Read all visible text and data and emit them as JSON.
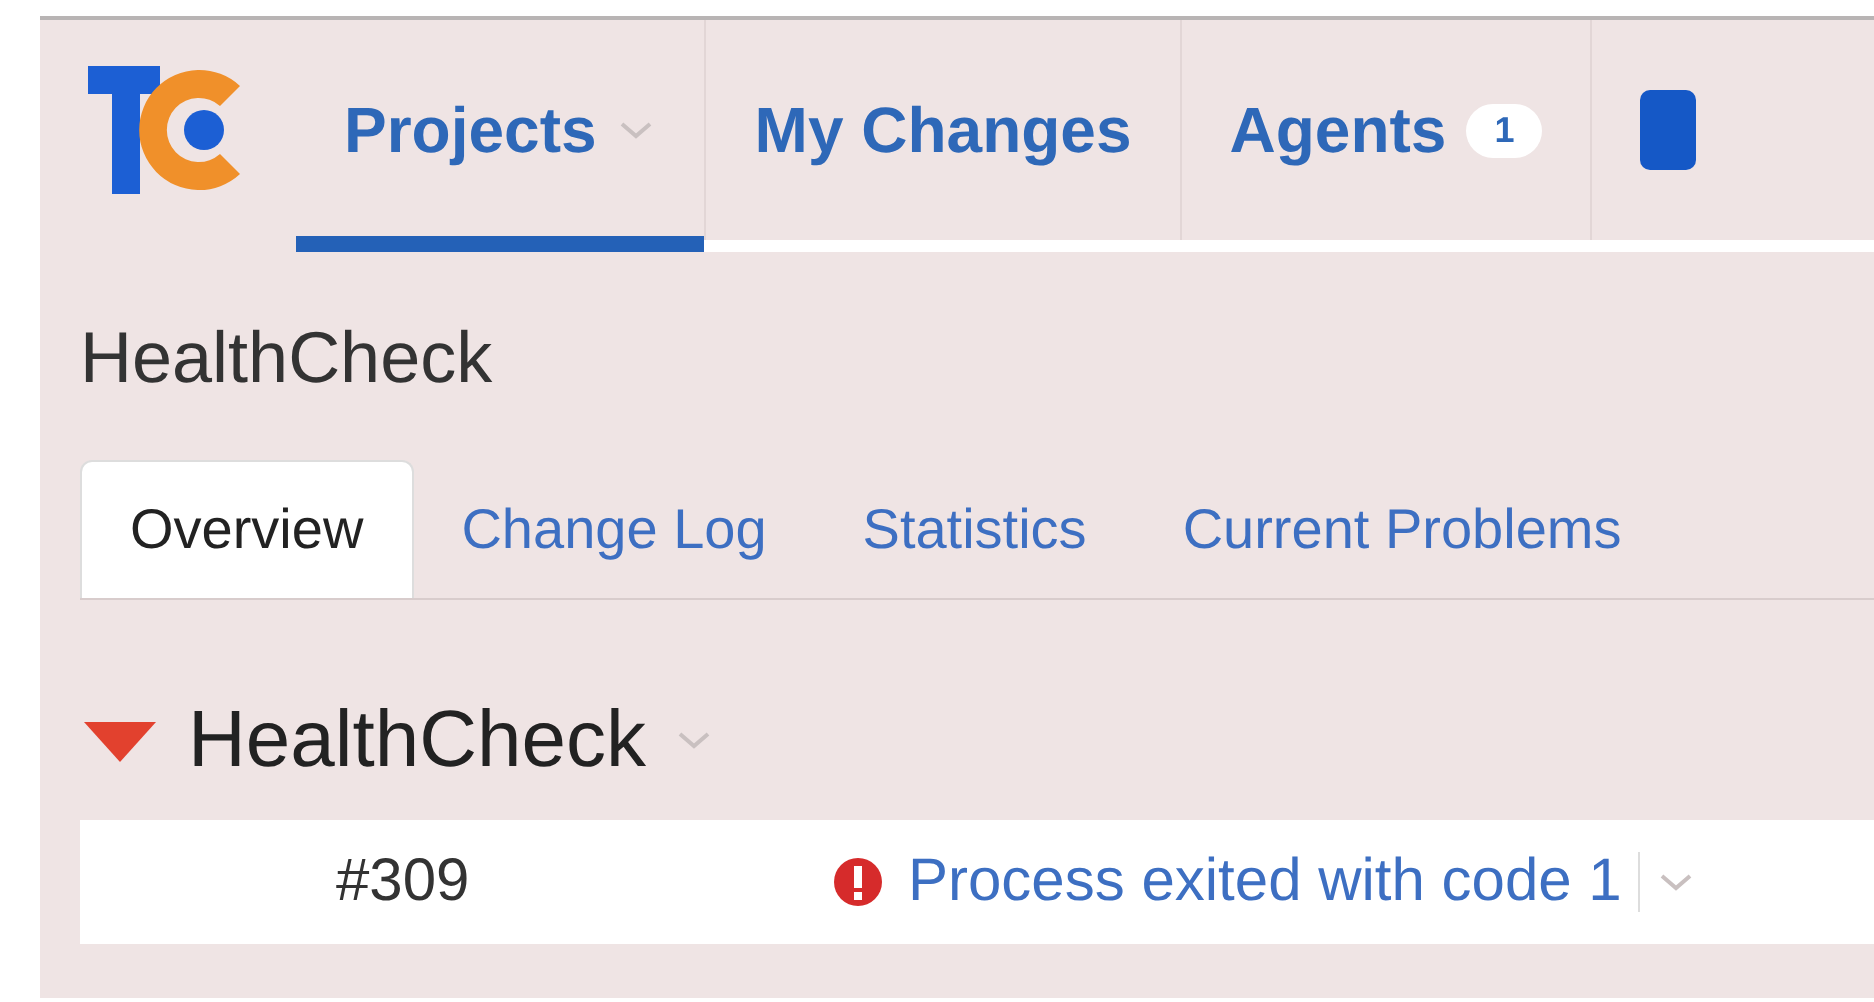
{
  "nav": [
    {
      "label": "Projects",
      "selected": true,
      "dropdown": true
    },
    {
      "label": "My Changes",
      "selected": false,
      "dropdown": false
    },
    {
      "label": "Agents",
      "selected": false,
      "dropdown": false,
      "badge": "1"
    }
  ],
  "page_title": "HealthCheck",
  "tabs": [
    {
      "label": "Overview",
      "selected": true
    },
    {
      "label": "Change Log",
      "selected": false
    },
    {
      "label": "Statistics",
      "selected": false
    },
    {
      "label": "Current Problems",
      "selected": false
    }
  ],
  "project": {
    "name": "HealthCheck",
    "expanded": true,
    "builds": [
      {
        "number": "#309",
        "kind": "failed",
        "message": "Process exited with code 1"
      }
    ]
  }
}
